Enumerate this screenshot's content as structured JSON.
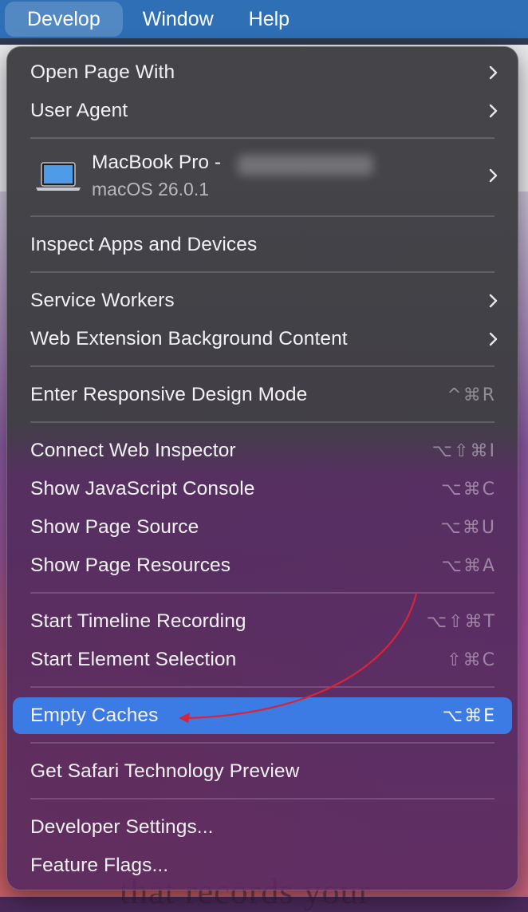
{
  "menubar": {
    "items": [
      "Develop",
      "Window",
      "Help"
    ]
  },
  "menu": {
    "open_page_with": {
      "label": "Open Page With"
    },
    "user_agent": {
      "label": "User Agent"
    },
    "device": {
      "name": "MacBook Pro -",
      "os": "macOS 26.0.1",
      "icon": "laptop-icon"
    },
    "inspect_apps": {
      "label": "Inspect Apps and Devices"
    },
    "service_workers": {
      "label": "Service Workers"
    },
    "web_extension": {
      "label": "Web Extension Background Content"
    },
    "responsive": {
      "label": "Enter Responsive Design Mode",
      "shortcut": "^⌘R"
    },
    "connect_inspector": {
      "label": "Connect Web Inspector",
      "shortcut": "⌥⇧⌘I"
    },
    "js_console": {
      "label": "Show JavaScript Console",
      "shortcut": "⌥⌘C"
    },
    "page_source": {
      "label": "Show Page Source",
      "shortcut": "⌥⌘U"
    },
    "page_resources": {
      "label": "Show Page Resources",
      "shortcut": "⌥⌘A"
    },
    "timeline": {
      "label": "Start Timeline Recording",
      "shortcut": "⌥⇧⌘T"
    },
    "element_selection": {
      "label": "Start Element Selection",
      "shortcut": "⇧⌘C"
    },
    "empty_caches": {
      "label": "Empty Caches",
      "shortcut": "⌥⌘E"
    },
    "tech_preview": {
      "label": "Get Safari Technology Preview"
    },
    "dev_settings": {
      "label": "Developer Settings..."
    },
    "feature_flags": {
      "label": "Feature Flags..."
    }
  },
  "background": {
    "text": "that records your"
  },
  "colors": {
    "menubar": "#2e6fb6",
    "selection": "#3c7be3",
    "annotation_arrow": "#d8243a"
  }
}
